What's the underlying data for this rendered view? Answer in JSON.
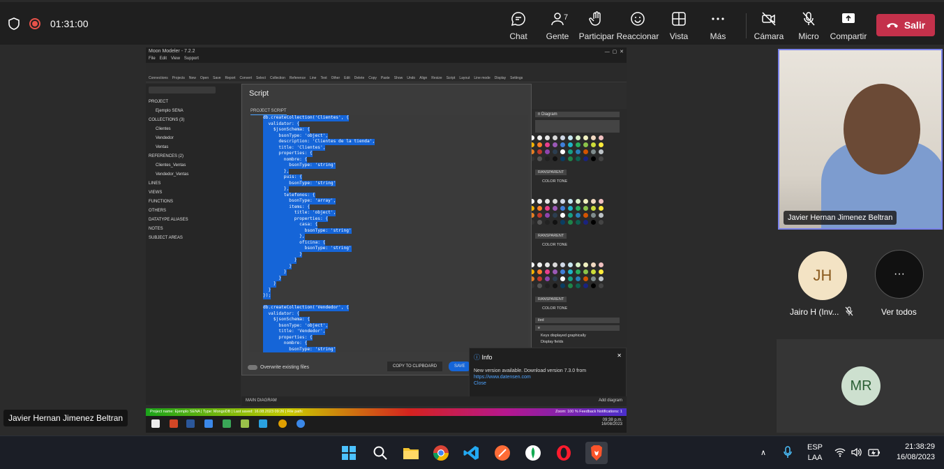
{
  "meeting": {
    "timer": "01:31:00",
    "controls": {
      "chat": "Chat",
      "people": "Gente",
      "people_count": "7",
      "raise": "Participar",
      "react": "Reaccionar",
      "view": "Vista",
      "more": "Más",
      "camera": "Cámara",
      "mic": "Micro",
      "share": "Compartir",
      "leave": "Salir"
    },
    "presenter_name": "Javier Hernan Jimenez Beltran",
    "camera_tile_name": "Javier Hernan Jimenez Beltran",
    "participants": [
      {
        "initials": "JH",
        "name": "Jairo H (Inv..."
      },
      {
        "initials": "MR",
        "name": ""
      }
    ],
    "see_all": "Ver todos",
    "see_all_glyph": "···",
    "accent_color": "#7b83eb",
    "leave_color": "#c4314b"
  },
  "shared_app": {
    "title": "Moon Modeler - 7.2.2",
    "menu": [
      "File",
      "Edit",
      "View",
      "Support"
    ],
    "toolbar": [
      "Connections",
      "Projects",
      "New",
      "Open",
      "Save",
      "Report",
      "Convert",
      "Select",
      "Collection",
      "Reference",
      "Line",
      "Text",
      "Other",
      "Edit",
      "Delete",
      "Copy",
      "Paste",
      "Show",
      "Undo",
      "Align",
      "Resize",
      "Script",
      "Layout",
      "Line mode",
      "Display",
      "Settings"
    ],
    "tree": [
      "PROJECT",
      "Ejemplo SENA",
      "COLLECTIONS (3)",
      "Clientes",
      "Vendedor",
      "Ventas",
      "REFERENCES (2)",
      "Clientes_Ventas",
      "Vendedor_Ventas",
      "LINES",
      "VIEWS",
      "FUNCTIONS",
      "OTHERS",
      "DATATYPE ALIASES",
      "NOTES",
      "SUBJECT AREAS"
    ],
    "script_dialog": {
      "title": "Script",
      "tab": "PROJECT SCRIPT",
      "code_lines": [
        "db.createCollection('Clientes', {",
        "  validator: {",
        "    $jsonSchema: {",
        "      bsonType: 'object',",
        "      description: 'Clientes de la tienda',",
        "      title: 'Clientes',",
        "      properties: {",
        "        nombre: {",
        "          bsonType: 'string'",
        "        },",
        "        puis: {",
        "          bsonType: 'string'",
        "        },",
        "        telefonos: {",
        "          bsonType: 'array',",
        "          items: {",
        "            title: 'object',",
        "            properties: {",
        "              casa: {",
        "                bsonType: 'string'",
        "              },",
        "              oficina: {",
        "                bsonType: 'string'",
        "              }",
        "            }",
        "          }",
        "        }",
        "      }",
        "    }",
        "  }",
        "});",
        "",
        "db.createCollection('Vendedor', {",
        "  validator: {",
        "    $jsonSchema: {",
        "      bsonType: 'object',",
        "      title: 'Vendedor',",
        "      properties: {",
        "        nombre: {",
        "          bsonType: 'string'"
      ],
      "overwrite_label": "Overwrite existing files",
      "copy_label": "COPY TO CLIPBOARD",
      "save_label": "SAVE"
    },
    "right_panel": {
      "diagram_name": "n Diagram",
      "transparent": "RANSPARENT",
      "color_tone": "COLOR TONE",
      "keys_label": "Keys displayed graphically",
      "fields_label": "Display fields",
      "select_1": "iled",
      "select_2": "e"
    },
    "info": {
      "title": "Info",
      "message": "New version available. Download version 7.3.0 from",
      "link": "https://www.datensen.com",
      "close": "Close"
    },
    "bottom_tab": "MAIN DIAGRAM",
    "add_diagram": "Add diagram",
    "status": "Project name: Ejemplo SENA  |  Type: MongoDB  |  Last saved: 16.08.2023 09:26  |  File path:",
    "status_right": "Zoom: 100 %     Feedback     Notifications: 1",
    "clock_time": "09:38 p.m.",
    "clock_date": "16/08/2023"
  },
  "tray": {
    "lang": "ESP",
    "layout": "LAA",
    "time": "21:38:29",
    "date": "16/08/2023"
  }
}
